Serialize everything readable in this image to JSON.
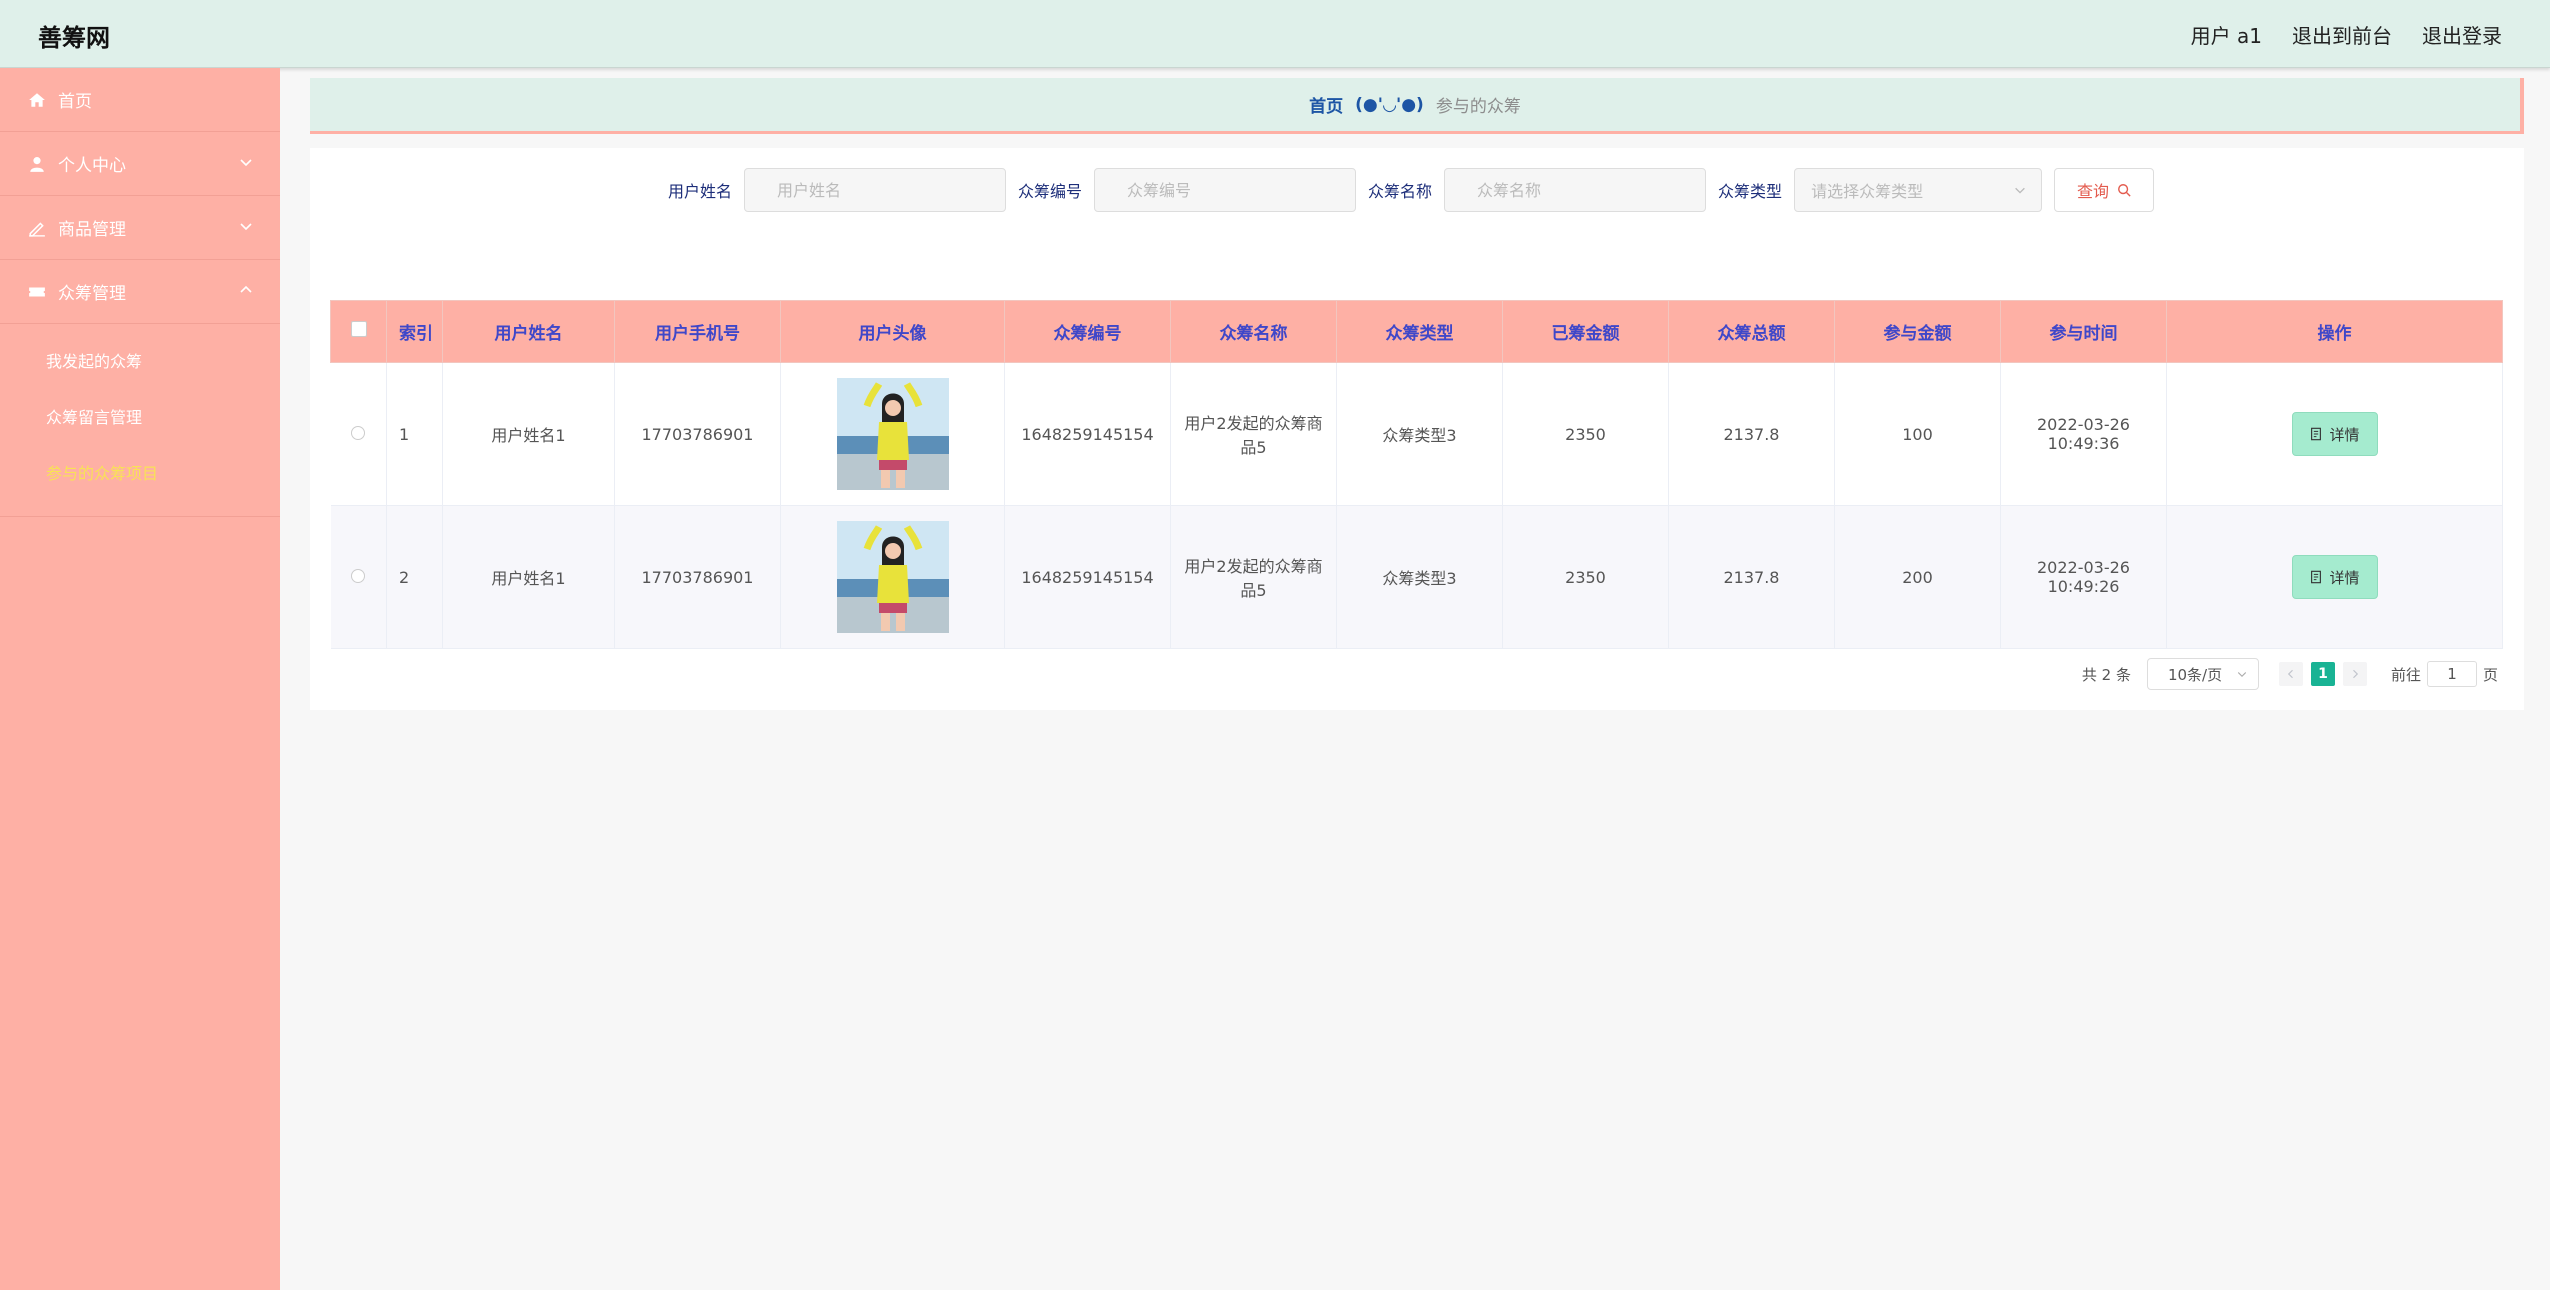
{
  "header": {
    "brand": "善筹网",
    "user": "用户 a1",
    "to_front": "退出到前台",
    "logout": "退出登录"
  },
  "sidebar": {
    "items": [
      {
        "label": "首页",
        "icon": "home-icon"
      },
      {
        "label": "个人中心",
        "icon": "user-icon"
      },
      {
        "label": "商品管理",
        "icon": "edit-icon"
      },
      {
        "label": "众筹管理",
        "icon": "ticket-icon"
      }
    ],
    "submenu": [
      {
        "label": "我发起的众筹"
      },
      {
        "label": "众筹留言管理"
      },
      {
        "label": "参与的众筹项目"
      }
    ]
  },
  "breadcrumb": {
    "home": "首页",
    "sep": "(●'◡'●)",
    "current": "参与的众筹"
  },
  "search": {
    "username_label": "用户姓名",
    "username_placeholder": "用户姓名",
    "code_label": "众筹编号",
    "code_placeholder": "众筹编号",
    "name_label": "众筹名称",
    "name_placeholder": "众筹名称",
    "type_label": "众筹类型",
    "type_placeholder": "请选择众筹类型",
    "query_button": "查询"
  },
  "table": {
    "headers": [
      "索引",
      "用户姓名",
      "用户手机号",
      "用户头像",
      "众筹编号",
      "众筹名称",
      "众筹类型",
      "已筹金额",
      "众筹总额",
      "参与金额",
      "参与时间",
      "操作"
    ],
    "rows": [
      {
        "index": "1",
        "username": "用户姓名1",
        "phone": "17703786901",
        "code": "1648259145154",
        "name": "用户2发起的众筹商品5",
        "type": "众筹类型3",
        "raised": "2350",
        "total": "2137.8",
        "amount": "100",
        "time": "2022-03-26 10:49:36",
        "action": "详情"
      },
      {
        "index": "2",
        "username": "用户姓名1",
        "phone": "17703786901",
        "code": "1648259145154",
        "name": "用户2发起的众筹商品5",
        "type": "众筹类型3",
        "raised": "2350",
        "total": "2137.8",
        "amount": "200",
        "time": "2022-03-26 10:49:26",
        "action": "详情"
      }
    ]
  },
  "pagination": {
    "total": "共 2 条",
    "page_size": "10条/页",
    "current_page": "1",
    "goto_label": "前往",
    "goto_value": "1",
    "page_suffix": "页"
  },
  "colors": {
    "sidebar": "#feb0a5",
    "header": "#dff0ea",
    "header_text": "#3f47c9",
    "active_sub": "#f8e256",
    "detail_button": "#a5ebcf",
    "page_active": "#19b394"
  }
}
